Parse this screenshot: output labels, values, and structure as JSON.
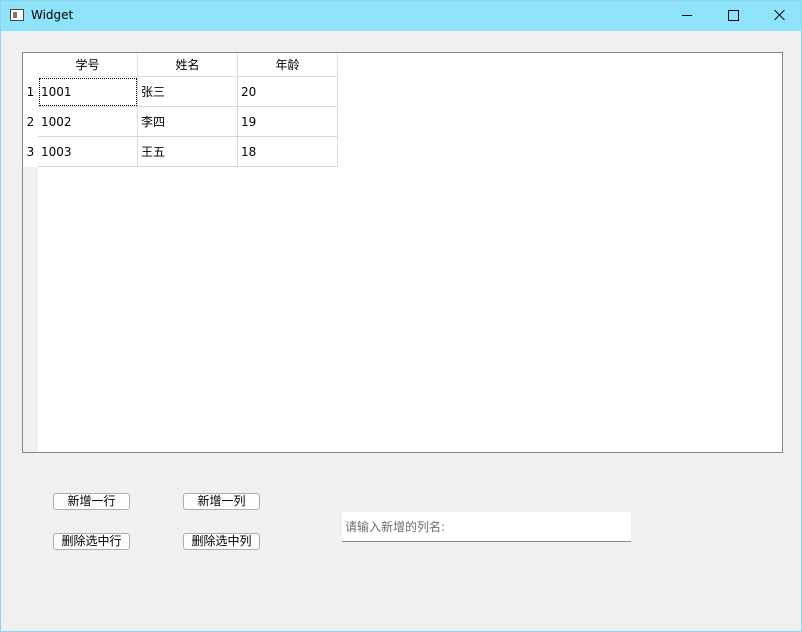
{
  "window": {
    "title": "Widget"
  },
  "table": {
    "headers": [
      "学号",
      "姓名",
      "年龄"
    ],
    "row_numbers": [
      "1",
      "2",
      "3"
    ],
    "rows": [
      [
        "1001",
        "张三",
        "20"
      ],
      [
        "1002",
        "李四",
        "19"
      ],
      [
        "1003",
        "王五",
        "18"
      ]
    ],
    "focused_cell": "1001"
  },
  "buttons": {
    "add_row": "新增一行",
    "add_column": "新增一列",
    "delete_row": "删除选中行",
    "delete_column": "删除选中列"
  },
  "column_name_input": {
    "placeholder": "请输入新增的列名:",
    "value": ""
  },
  "icons": [
    "app-window-icon",
    "minimize-icon",
    "maximize-icon",
    "close-icon"
  ]
}
